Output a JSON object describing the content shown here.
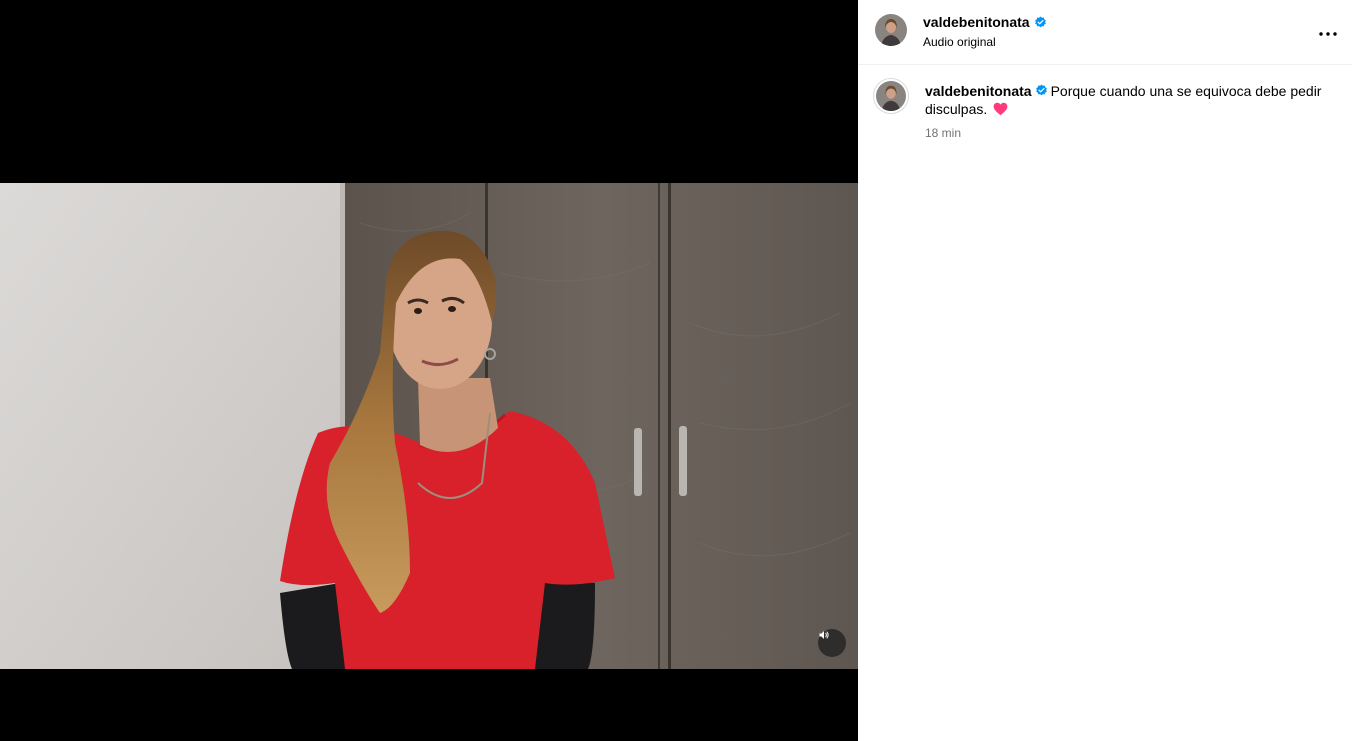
{
  "post": {
    "username": "valdebenitonata",
    "audio_label": "Audio original",
    "caption_text": "Porque cuando una se equivoca debe pedir disculpas.",
    "caption_emoji": "heart-emoji",
    "timestamp": "18 min"
  },
  "video": {
    "mute_icon": "speaker-icon"
  },
  "colors": {
    "verified_badge": "#0095f6",
    "heart": "#ff3b7f",
    "muted_text": "#737373"
  }
}
